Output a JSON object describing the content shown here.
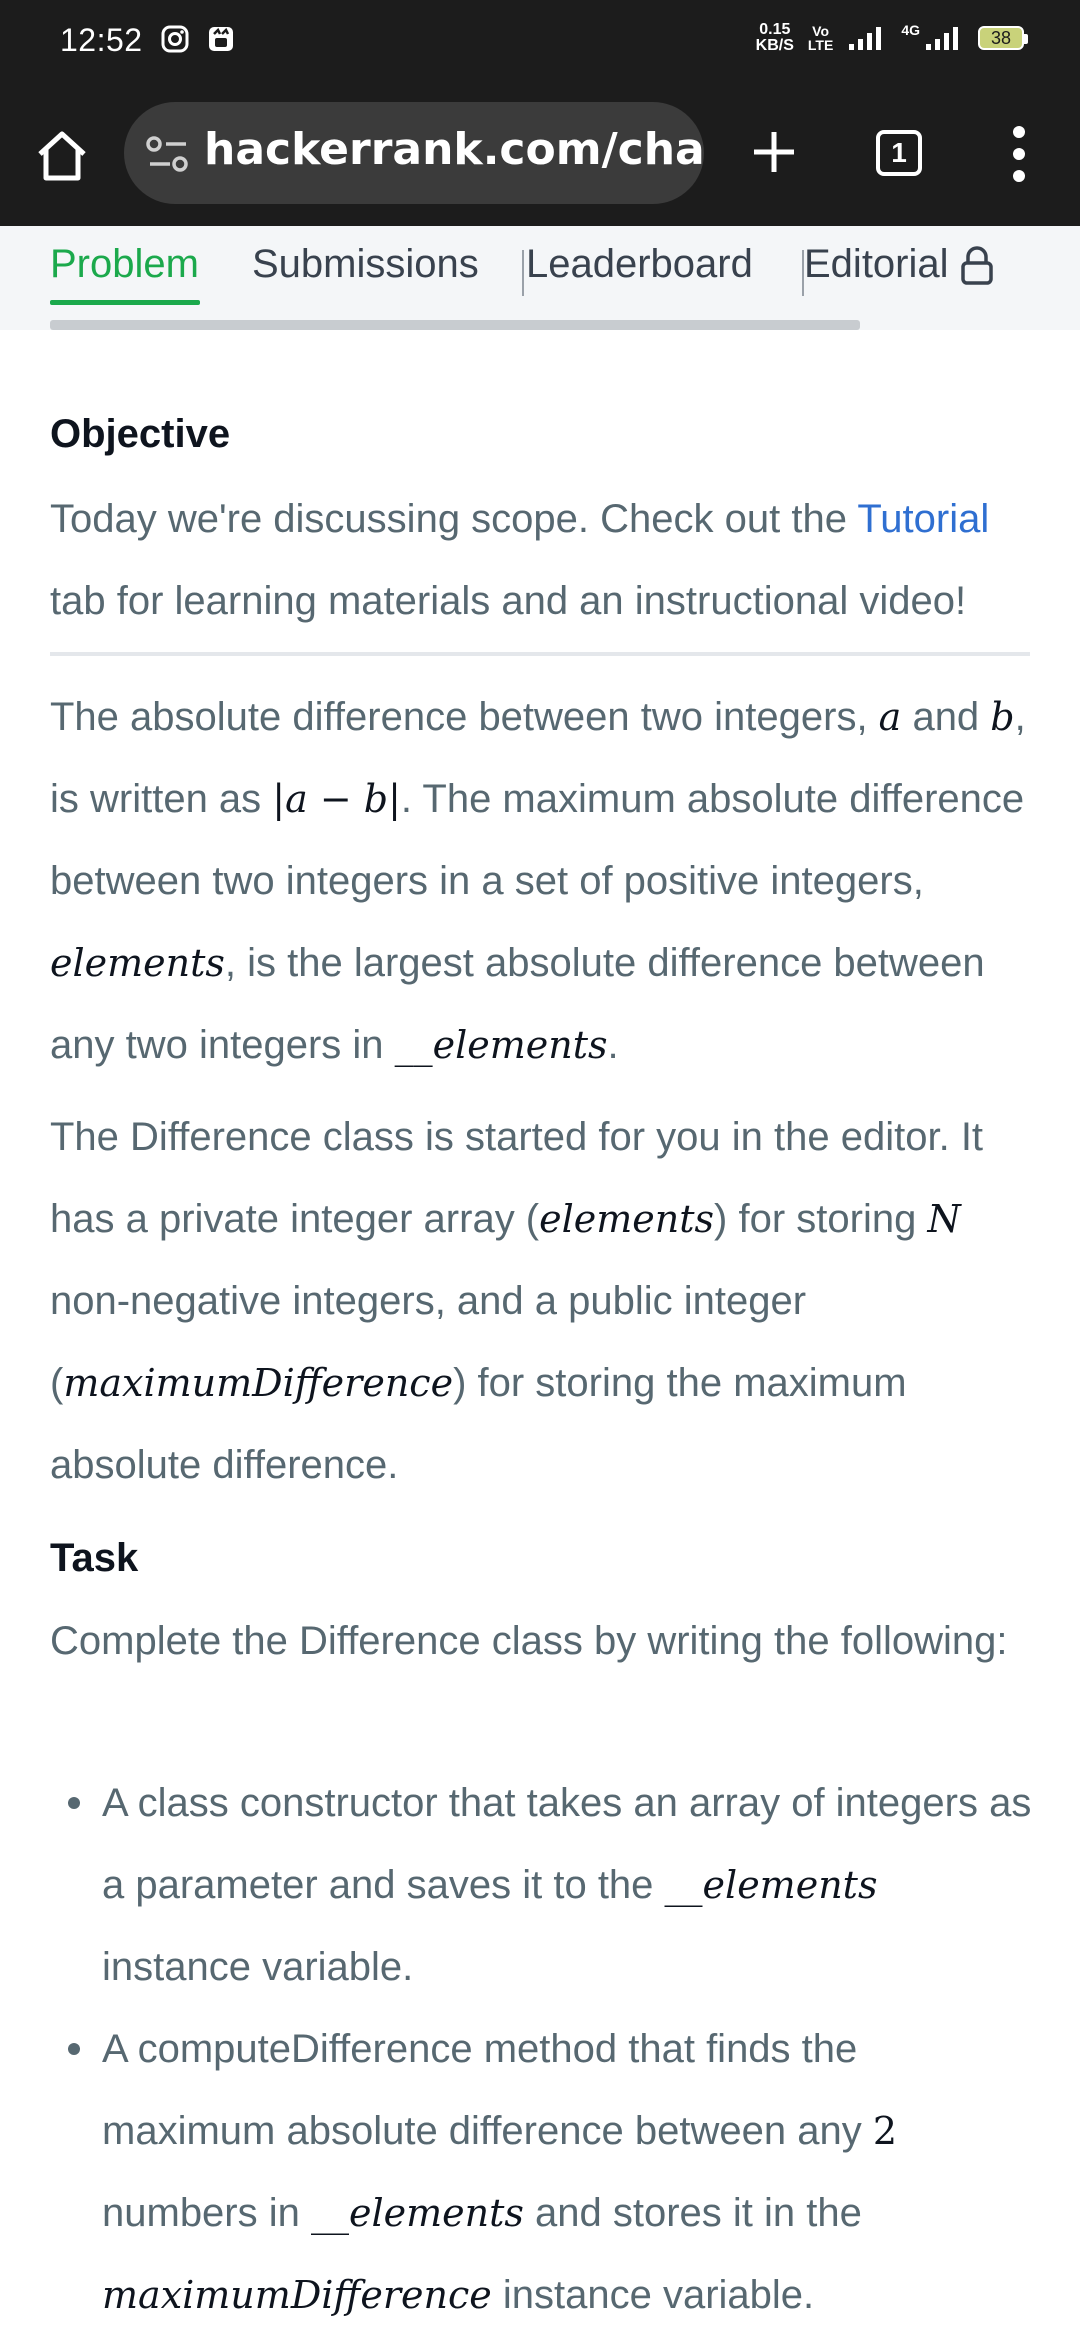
{
  "status_bar": {
    "time": "12:52",
    "net_speed_value": "0.15",
    "net_speed_unit": "KB/S",
    "volte_top": "Vo",
    "volte_bottom": "LTE",
    "network_label": "4G",
    "battery": "38"
  },
  "browser": {
    "url": "hackerrank.com/challenges",
    "tab_count": "1"
  },
  "tabs": [
    {
      "label": "Problem"
    },
    {
      "label": "Submissions"
    },
    {
      "label": "Leaderboard"
    },
    {
      "label": "Editorial"
    }
  ],
  "colors": {
    "accent_green": "#1ba94c",
    "link_blue": "#2f6fd1",
    "text_gray": "#576871"
  },
  "content": {
    "objective_heading": "Objective",
    "objective_text_1": "Today we're discussing scope. Check out the ",
    "objective_link": "Tutorial",
    "objective_text_2": " tab for learning materials and an instructional video!",
    "p1_a": "The absolute difference between two integers, ",
    "var_a": "a",
    "p1_and": " and ",
    "var_b": "b",
    "p1_b": ", is written as ",
    "abs_expr": "|a − b|",
    "p1_c": ". The maximum absolute difference between two integers in a set of positive integers, ",
    "var_elements": "elements",
    "p1_d": ", is the largest absolute difference between any two integers in ",
    "var_u_elements": "__elements",
    "p1_e": ".",
    "p2_a": "The Difference class is started for you in the editor. It has a private integer array (",
    "p2_elements": "elements",
    "p2_b": ") for storing ",
    "var_N": "N",
    "p2_c": " non-negative integers, and a public integer (",
    "var_maxdiff": "maximumDifference",
    "p2_d": ") for storing the maximum absolute difference.",
    "task_heading": "Task",
    "task_intro": "Complete the Difference class by writing the following:",
    "bullet1_a": "A class constructor that takes an array of integers as a parameter and saves it to the ",
    "bullet1_var": "__elements",
    "bullet1_b": " instance variable.",
    "bullet2_a": "A computeDifference method that finds the maximum absolute difference between any ",
    "bullet2_num": "2",
    "bullet2_b": " numbers in ",
    "bullet2_var": "__elements",
    "bullet2_c": " and stores it in the ",
    "bullet2_var2": "maximumDifference",
    "bullet2_d": " instance variable."
  }
}
